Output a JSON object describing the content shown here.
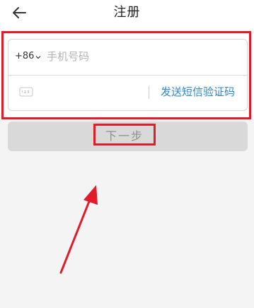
{
  "header": {
    "title": "注册"
  },
  "form": {
    "country_code": "+86",
    "phone_placeholder": "手机号码",
    "code_placeholder": "",
    "send_code_label": "发送短信验证码"
  },
  "actions": {
    "next_label": "下一步"
  },
  "colors": {
    "annotation_red": "#e01b2a",
    "link_blue": "#2e86d9",
    "disabled_button_bg": "#d9d9d9",
    "page_bg": "#f4f4f4"
  },
  "icons": {
    "back": "back-arrow-icon",
    "country_dropdown": "chevron-down-icon",
    "verification_code": "code-123-icon"
  }
}
